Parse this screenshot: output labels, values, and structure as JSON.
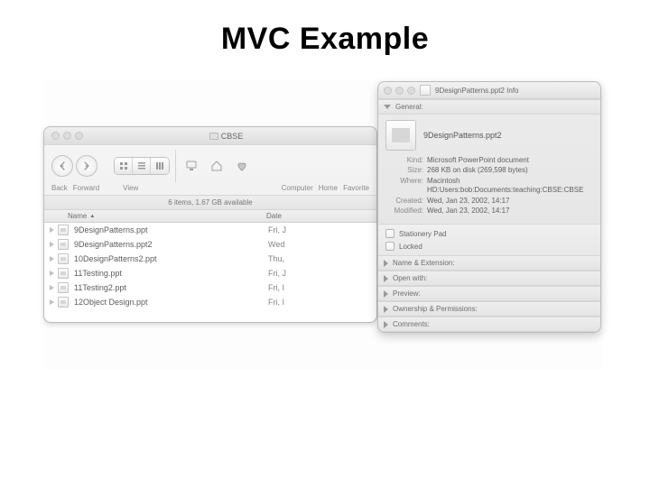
{
  "slide": {
    "title": "MVC Example"
  },
  "finder": {
    "window_title": "CBSE",
    "toolbar": {
      "back": "Back",
      "forward": "Forward",
      "view": "View",
      "computer": "Computer",
      "home": "Home",
      "favorite": "Favorite"
    },
    "status": "6 items, 1.67 GB available",
    "columns": {
      "name": "Name",
      "date": "Date"
    },
    "rows": [
      {
        "name": "9DesignPatterns.ppt",
        "date": "Fri, J"
      },
      {
        "name": "9DesignPatterns.ppt2",
        "date": "Wed"
      },
      {
        "name": "10DesignPatterns2.ppt",
        "date": "Thu,"
      },
      {
        "name": "11Testing.ppt",
        "date": "Fri, J"
      },
      {
        "name": "11Testing2.ppt",
        "date": "Fri, I"
      },
      {
        "name": "12Object Design.ppt",
        "date": "Fri, I"
      }
    ]
  },
  "info": {
    "title": "9DesignPatterns.ppt2 Info",
    "sections": {
      "general": "General:",
      "name_ext": "Name & Extension:",
      "open_with": "Open with:",
      "preview": "Preview:",
      "ownership": "Ownership & Permissions:",
      "comments": "Comments:"
    },
    "filename": "9DesignPatterns.ppt2",
    "kv": {
      "kind_k": "Kind:",
      "kind_v": "Microsoft PowerPoint document",
      "size_k": "Size:",
      "size_v": "268 KB on disk (269,598 bytes)",
      "where_k": "Where:",
      "where_v": "Macintosh HD:Users:bob:Documents:teaching:CBSE:CBSE",
      "created_k": "Created:",
      "created_v": "Wed, Jan 23, 2002, 14:17",
      "modified_k": "Modified:",
      "modified_v": "Wed, Jan 23, 2002, 14:17"
    },
    "checks": {
      "stationery": "Stationery Pad",
      "locked": "Locked"
    }
  }
}
